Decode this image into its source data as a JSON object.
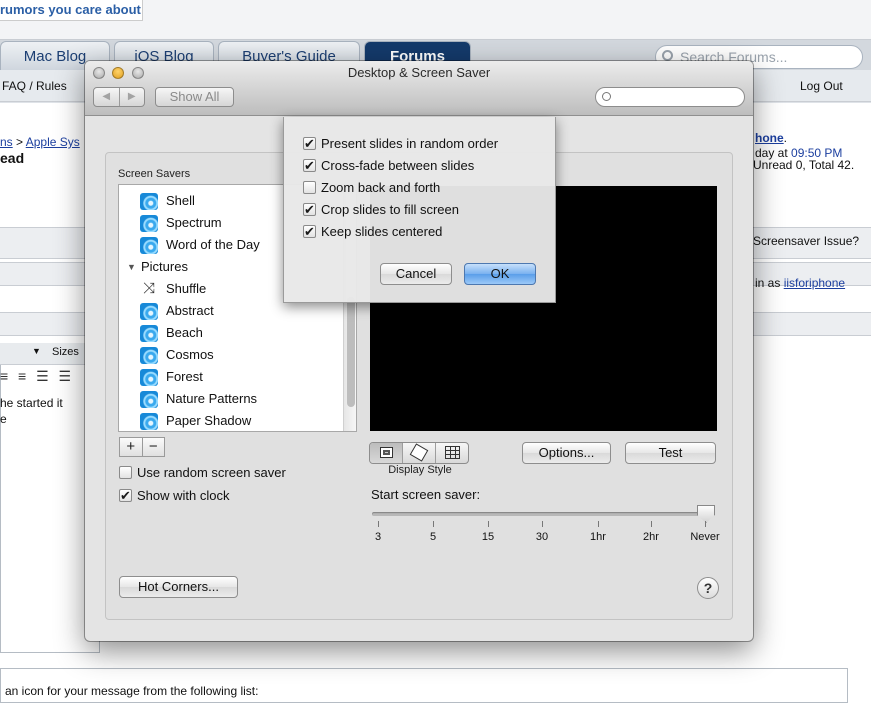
{
  "background": {
    "logo_text": "rumors you care about",
    "tabs": [
      {
        "label": "Mac Blog"
      },
      {
        "label": "iOS Blog"
      },
      {
        "label": "Buyer's Guide"
      },
      {
        "label": "Forums"
      }
    ],
    "search_placeholder": "Search Forums...",
    "faq_rules": "FAQ / Rules",
    "log_out": "Log Out",
    "breadcrumb_start": "ns",
    "breadcrumb_sep": ">",
    "breadcrumb_link": "Apple Sys",
    "thread_title_fragment": "ead",
    "user_link_fragment": "hone",
    "user_link_dot": ".",
    "last_visit_text": "day at",
    "last_visit_time": "09:50 PM",
    "unread_text": "Unread 0, Total 42.",
    "thread_topic": "Screensaver Issue?",
    "logged_in_text": "in as",
    "logged_in_user": "iisforiphone",
    "sizes_label": "Sizes",
    "editor_line1": "he started it",
    "editor_line2": "e",
    "icon_prompt": "an icon for your message from the following list:"
  },
  "window": {
    "title": "Desktop & Screen Saver",
    "show_all": "Show All",
    "screen_savers_label": "Screen Savers",
    "list": [
      {
        "label": "Shell",
        "icon": "screensaver-icon"
      },
      {
        "label": "Spectrum",
        "icon": "screensaver-icon"
      },
      {
        "label": "Word of the Day",
        "icon": "screensaver-icon"
      },
      {
        "label": "Pictures",
        "icon": "disclosure-triangle-icon"
      },
      {
        "label": "Shuffle",
        "icon": "shuffle-icon"
      },
      {
        "label": "Abstract",
        "icon": "screensaver-icon"
      },
      {
        "label": "Beach",
        "icon": "screensaver-icon"
      },
      {
        "label": "Cosmos",
        "icon": "screensaver-icon"
      },
      {
        "label": "Forest",
        "icon": "screensaver-icon"
      },
      {
        "label": "Nature Patterns",
        "icon": "screensaver-icon"
      },
      {
        "label": "Paper Shadow",
        "icon": "screensaver-icon"
      }
    ],
    "plus": "+",
    "minus": "−",
    "use_random": {
      "label": "Use random screen saver",
      "checked": false
    },
    "show_clock": {
      "label": "Show with clock",
      "checked": true
    },
    "display_style_label": "Display Style",
    "display_style_selected": "single",
    "options_button": "Options...",
    "test_button": "Test",
    "start_label": "Start screen saver:",
    "slider_ticks": [
      "3",
      "5",
      "15",
      "30",
      "1hr",
      "2hr",
      "Never"
    ],
    "slider_value": "Never",
    "hot_corners_button": "Hot Corners...",
    "help_glyph": "?"
  },
  "options_sheet": {
    "items": [
      {
        "label": "Present slides in random order",
        "checked": true
      },
      {
        "label": "Cross-fade between slides",
        "checked": true
      },
      {
        "label": "Zoom back and forth",
        "checked": false
      },
      {
        "label": "Crop slides to fill screen",
        "checked": true
      },
      {
        "label": "Keep slides centered",
        "checked": true
      }
    ],
    "cancel": "Cancel",
    "ok": "OK"
  },
  "colors": {
    "forums_tab": "#143a6b",
    "link": "#1c3f9f",
    "ok_button": "#5a9ee9",
    "preview": "#000000"
  }
}
